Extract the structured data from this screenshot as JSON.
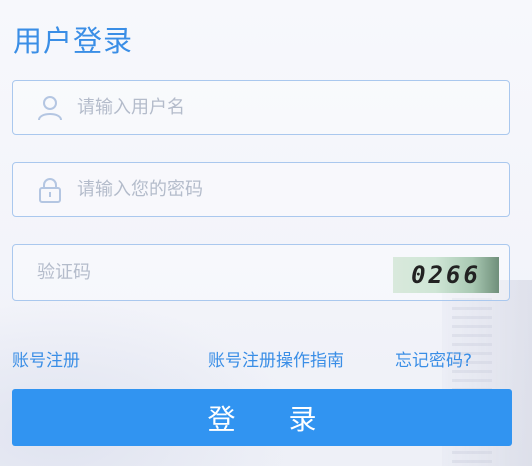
{
  "title": "用户登录",
  "username": {
    "placeholder": "请输入用户名",
    "value": ""
  },
  "password": {
    "placeholder": "请输入您的密码",
    "value": ""
  },
  "captcha": {
    "placeholder": "验证码",
    "value": "",
    "image_text": "0266"
  },
  "links": {
    "register": "账号注册",
    "guide": "账号注册操作指南",
    "forgot": "忘记密码?"
  },
  "login_button": "登 录",
  "icons": {
    "username": "user-icon",
    "password": "lock-icon"
  },
  "colors": {
    "accent": "#3a8ee6",
    "button": "#3194f1",
    "border": "#aac8ee"
  }
}
